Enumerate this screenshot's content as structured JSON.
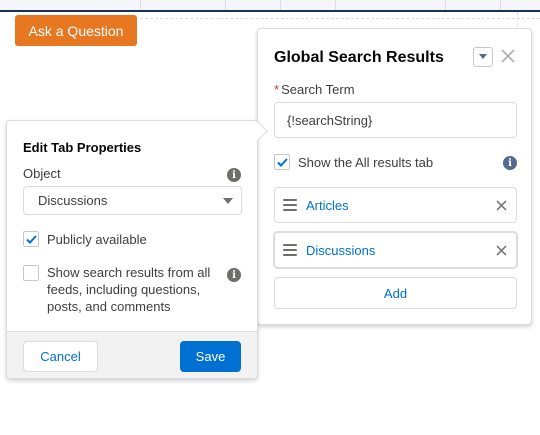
{
  "colors": {
    "brand_blue": "#0070d2",
    "ask_button_orange": "#e87722",
    "required_red": "#c23934",
    "border": "#dddbda"
  },
  "background": {
    "ask_button_label": "Ask a Question"
  },
  "global_search": {
    "title": "Global Search Results",
    "menu_icon": "chevron-down-icon",
    "close_icon": "close-icon",
    "search_term_required_mark": "*",
    "search_term_label": "Search Term",
    "search_term_value": "{!searchString}",
    "show_all_tab_label": "Show the All results tab",
    "show_all_tab_checked": true,
    "tabs": [
      {
        "label": "Articles"
      },
      {
        "label": "Discussions",
        "active": true
      }
    ],
    "add_label": "Add"
  },
  "edit_tab": {
    "title": "Edit Tab Properties",
    "object_label": "Object",
    "object_selected": "Discussions",
    "publicly_available_label": "Publicly available",
    "publicly_available_checked": true,
    "show_feeds_label": "Show search results from all feeds, including questions, posts, and comments",
    "show_feeds_checked": false,
    "cancel_label": "Cancel",
    "save_label": "Save"
  }
}
